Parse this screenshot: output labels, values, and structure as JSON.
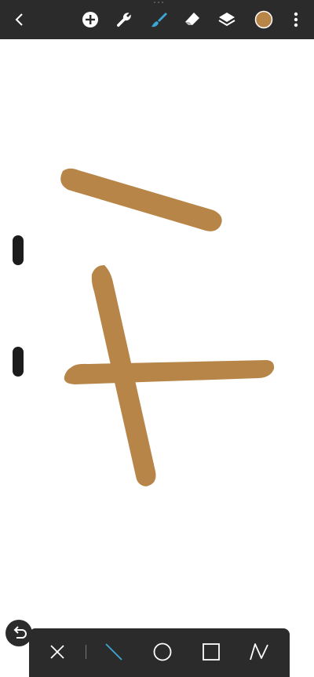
{
  "colors": {
    "toolbar_bg": "#2b2b2b",
    "icon": "#ffffff",
    "active_tool": "#3aa7d6",
    "stroke_color": "#b88548"
  },
  "toolbar": {
    "icons": [
      "back-icon",
      "add-icon",
      "wrench-icon",
      "brush-icon",
      "eraser-icon",
      "layers-icon",
      "color-swatch",
      "more-icon"
    ],
    "active": "brush-icon"
  },
  "shape_tools": {
    "icons": [
      "close-icon",
      "line-icon",
      "circle-icon",
      "square-icon",
      "zigzag-icon"
    ],
    "active": "line-icon"
  },
  "strokes_count": 3
}
